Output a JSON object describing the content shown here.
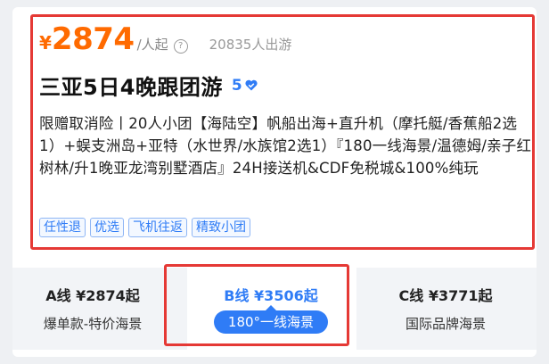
{
  "price": {
    "symbol": "¥",
    "amount": "2874",
    "unit": "/人起",
    "info_icon": "?",
    "sold_count": "20835人出游"
  },
  "product": {
    "title": "三亚5日4晚跟团游",
    "rating": "5",
    "description": "限赠取消险丨20人小团【海陆空】帆船出海+直升机（摩托艇/香蕉船2选1）+蜈支洲岛+亚特（水世界/水族馆2选1）『180一线海景/温德姆/亲子红树林/升1晚亚龙湾别墅酒店』24H接送机&CDF免税城&100%纯玩",
    "tags": [
      "任性退",
      "优选",
      "飞机往返",
      "精致小团"
    ]
  },
  "options": [
    {
      "title": "A线 ¥2874起",
      "subtitle": "爆单款-特价海景"
    },
    {
      "title": "B线 ¥3506起",
      "subtitle": "180°一线海景"
    },
    {
      "title": "C线 ¥3771起",
      "subtitle": "国际品牌海景"
    }
  ],
  "colors": {
    "accent_orange": "#ff6a00",
    "accent_blue": "#2f7cf6",
    "highlight_red": "#e53935"
  },
  "icons": {
    "info": "info-icon",
    "rating": "heart-check-icon"
  }
}
